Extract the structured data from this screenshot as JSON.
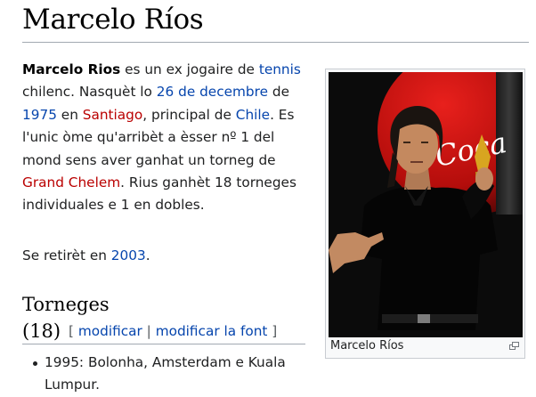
{
  "page": {
    "title": "Marcelo Ríos"
  },
  "intro": {
    "name_bold": "Marcelo Rios",
    "t1": " es un ex jogaire de ",
    "link_tennis": "tennis",
    "t2": " chilenc. Nasquèt lo ",
    "link_date": "26 de decembre",
    "t3": " de ",
    "link_year": "1975",
    "t4": " en ",
    "link_city": "Santiago",
    "t5": ", principal de ",
    "link_country": "Chile",
    "t6": ". Es l'unic òme qu'arribèt a èsser nº 1 del mond sens aver ganhat un torneg de ",
    "link_gc": "Grand Chelem",
    "t7": ". Rius ganhèt 18 torneges individuales e 1 en dobles."
  },
  "retire": {
    "t1": "Se retirèt en ",
    "link_year": "2003",
    "t2": "."
  },
  "section": {
    "heading": "Torneges (18)",
    "bracket_open": "[",
    "edit": "modificar",
    "sep": "|",
    "edit_source": "modificar la font",
    "bracket_close": "]"
  },
  "tournaments": [
    "1995: Bolonha, Amsterdam e Kuala Lumpur."
  ],
  "image": {
    "caption": "Marcelo Ríos",
    "bottle_text": "Coca"
  },
  "colors": {
    "link": "#0645ad",
    "redlink": "#ba0000",
    "text": "#202122"
  }
}
